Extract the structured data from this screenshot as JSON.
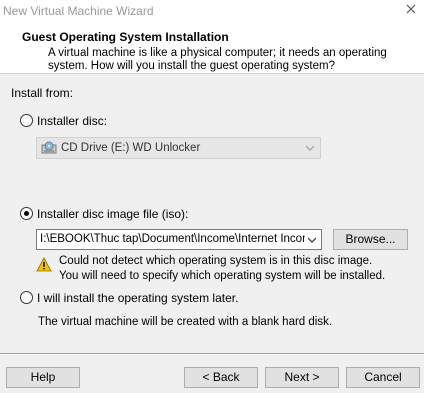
{
  "window": {
    "title": "New Virtual Machine Wizard"
  },
  "header": {
    "title": "Guest Operating System Installation",
    "description": "A virtual machine is like a physical computer; it needs an operating system. How will you install the guest operating system?"
  },
  "install_from": {
    "label": "Install from:",
    "disc_option": {
      "label": "Installer disc:",
      "selected": false
    },
    "disc_drive": {
      "value": "CD Drive (E:) WD Unlocker"
    },
    "iso_option": {
      "label": "Installer disc image file (iso):",
      "selected": true
    },
    "iso_path": {
      "value": "I:\\EBOOK\\Thuc tap\\Document\\Income\\Internet Incom"
    },
    "browse_label": "Browse...",
    "warning_line1": "Could not detect which operating system is in this disc image.",
    "warning_line2": "You will need to specify which operating system will be installed.",
    "later_option": {
      "label": "I will install the operating system later.",
      "selected": false
    },
    "later_desc": "The virtual machine will be created with a blank hard disk."
  },
  "footer": {
    "help_label": "Help",
    "back_label": "< Back",
    "next_label": "Next >",
    "cancel_label": "Cancel"
  },
  "icons": {
    "close": "close-icon",
    "disc": "cd-drive-icon",
    "warning": "warning-icon",
    "dropdown": "chevron-down-icon"
  },
  "colors": {
    "dialog_bg": "#f0f0f0",
    "header_bg": "#ffffff",
    "title_text": "#9a9a9a",
    "warning_yellow": "#f5c400"
  }
}
